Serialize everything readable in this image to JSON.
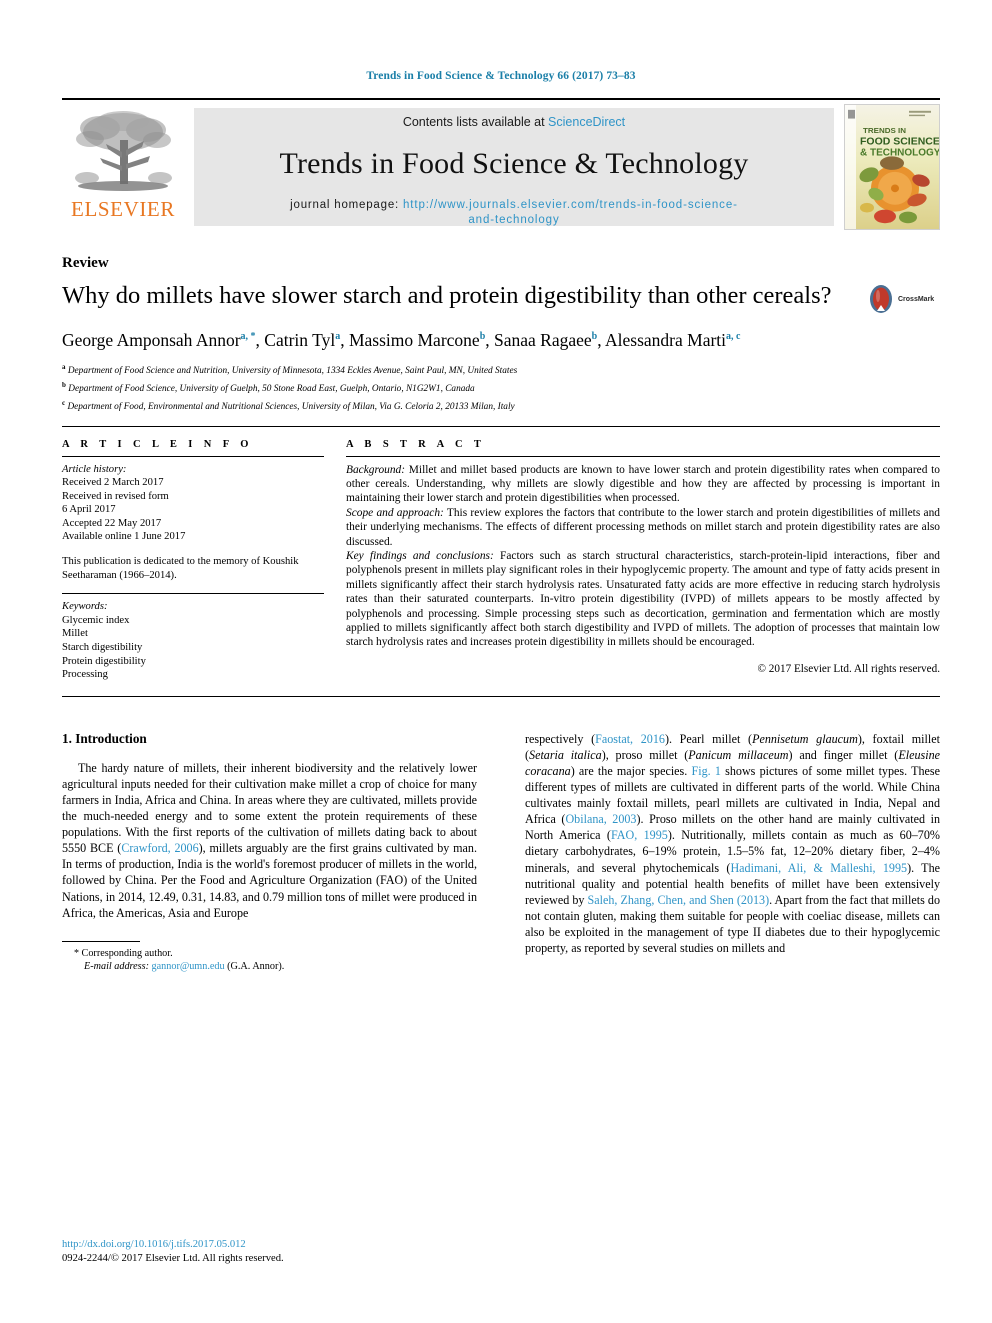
{
  "running_head": "Trends in Food Science & Technology 66 (2017) 73–83",
  "masthead": {
    "publisher": "ELSEVIER",
    "contents_prefix": "Contents lists available at ",
    "contents_link": "ScienceDirect",
    "journal_title": "Trends in Food Science & Technology",
    "homepage_prefix": "journal homepage: ",
    "homepage_url_line1": "http://www.journals.elsevier.com/trends-in-food-science-",
    "homepage_url_line2": "and-technology",
    "cover_title_line1": "TRENDS IN",
    "cover_title_line2": "FOOD SCIENCE",
    "cover_title_line3": "& TECHNOLOGY"
  },
  "article": {
    "doctype": "Review",
    "title": "Why do millets have slower starch and protein digestibility than other cereals?",
    "crossmark_label": "CrossMark",
    "authors_line1_parts": [
      {
        "name": "George Amponsah Annor",
        "sup": "a, *"
      },
      {
        "name": "Catrin Tyl",
        "sup": "a"
      },
      {
        "name": "Massimo Marcone",
        "sup": "b"
      },
      {
        "name": "Sanaa Ragaee",
        "sup": "b"
      }
    ],
    "authors_line2_parts": [
      {
        "name": "Alessandra Marti",
        "sup": "a, c"
      }
    ],
    "affiliations": [
      {
        "marker": "a",
        "text": "Department of Food Science and Nutrition, University of Minnesota, 1334 Eckles Avenue, Saint Paul, MN, United States"
      },
      {
        "marker": "b",
        "text": "Department of Food Science, University of Guelph, 50 Stone Road East, Guelph, Ontario, N1G2W1, Canada"
      },
      {
        "marker": "c",
        "text": "Department of Food, Environmental and Nutritional Sciences, University of Milan, Via G. Celoria 2, 20133 Milan, Italy"
      }
    ]
  },
  "article_info": {
    "heading": "A R T I C L E  I N F O",
    "history_label": "Article history:",
    "history_lines": [
      "Received 2 March 2017",
      "Received in revised form",
      "6 April 2017",
      "Accepted 22 May 2017",
      "Available online 1 June 2017"
    ],
    "dedication": "This publication is dedicated to the memory of Koushik Seetharaman (1966–2014).",
    "keywords_label": "Keywords:",
    "keywords": [
      "Glycemic index",
      "Millet",
      "Starch digestibility",
      "Protein digestibility",
      "Processing"
    ]
  },
  "abstract": {
    "heading": "A B S T R A C T",
    "background_label": "Background:",
    "background_text": " Millet and millet based products are known to have lower starch and protein digestibility rates when compared to other cereals. Understanding, why millets are slowly digestible and how they are affected by processing is important in maintaining their lower starch and protein digestibilities when processed.",
    "scope_label": "Scope and approach:",
    "scope_text": " This review explores the factors that contribute to the lower starch and protein digestibilities of millets and their underlying mechanisms. The effects of different processing methods on millet starch and protein digestibility rates are also discussed.",
    "findings_label": "Key findings and conclusions:",
    "findings_text": " Factors such as starch structural characteristics, starch-protein-lipid interactions, fiber and polyphenols present in millets play significant roles in their hypoglycemic property. The amount and type of fatty acids present in millets significantly affect their starch hydrolysis rates. Unsaturated fatty acids are more effective in reducing starch hydrolysis rates than their saturated counterparts. In-vitro protein digestibility (IVPD) of millets appears to be mostly affected by polyphenols and processing. Simple processing steps such as decortication, germination and fermentation which are mostly applied to millets significantly affect both starch digestibility and IVPD of millets. The adoption of processes that maintain low starch hydrolysis rates and increases protein digestibility in millets should be encouraged.",
    "copyright": "© 2017 Elsevier Ltd. All rights reserved."
  },
  "introduction": {
    "section_number_title": "1. Introduction",
    "left_paragraph": "The hardy nature of millets, their inherent biodiversity and the relatively lower agricultural inputs needed for their cultivation make millet a crop of choice for many farmers in India, Africa and China. In areas where they are cultivated, millets provide the much-needed energy and to some extent the protein requirements of these populations. With the first reports of the cultivation of millets dating back to about 5550 BCE (",
    "left_ref1": "Crawford, 2006",
    "left_paragraph_2": "), millets arguably are the first grains cultivated by man. In terms of production, India is the world's foremost producer of millets in the world, followed by China. Per the Food and Agriculture Organization (FAO) of the United Nations, in 2014, 12.49, 0.31, 14.83, and 0.79 million tons of millet were produced in Africa, the Americas, Asia and Europe",
    "right_segments": [
      {
        "t": "respectively (",
        "k": "plain"
      },
      {
        "t": "Faostat, 2016",
        "k": "ref"
      },
      {
        "t": "). Pearl millet (",
        "k": "plain"
      },
      {
        "t": "Pennisetum glaucum",
        "k": "ital"
      },
      {
        "t": "), foxtail millet (",
        "k": "plain"
      },
      {
        "t": "Setaria italica",
        "k": "ital"
      },
      {
        "t": "), proso millet (",
        "k": "plain"
      },
      {
        "t": "Panicum millaceum",
        "k": "ital"
      },
      {
        "t": ") and finger millet (",
        "k": "plain"
      },
      {
        "t": "Eleusine coracana",
        "k": "ital"
      },
      {
        "t": ") are the major species. ",
        "k": "plain"
      },
      {
        "t": "Fig. 1",
        "k": "ref"
      },
      {
        "t": " shows pictures of some millet types. These different types of millets are cultivated in different parts of the world. While China cultivates mainly foxtail millets, pearl millets are cultivated in India, Nepal and Africa (",
        "k": "plain"
      },
      {
        "t": "Obilana, 2003",
        "k": "ref"
      },
      {
        "t": "). Proso millets on the other hand are mainly cultivated in North America (",
        "k": "plain"
      },
      {
        "t": "FAO, 1995",
        "k": "ref"
      },
      {
        "t": "). Nutritionally, millets contain as much as 60–70% dietary carbohydrates, 6–19% protein, 1.5–5% fat, 12–20% dietary fiber, 2–4% minerals, and several phytochemicals (",
        "k": "plain"
      },
      {
        "t": "Hadimani, Ali, & Malleshi, 1995",
        "k": "ref"
      },
      {
        "t": "). The nutritional quality and potential health benefits of millet have been extensively reviewed by ",
        "k": "plain"
      },
      {
        "t": "Saleh, Zhang, Chen, and Shen (2013)",
        "k": "ref"
      },
      {
        "t": ". Apart from the fact that millets do not contain gluten, making them suitable for people with coeliac disease, millets can also be exploited in the management of type II diabetes due to their hypoglycemic property, as reported by several studies on millets and",
        "k": "plain"
      }
    ]
  },
  "footnotes": {
    "corresponding_star": "*",
    "corresponding_label": "Corresponding author.",
    "email_label": "E-mail address:",
    "email": "gannor@umn.edu",
    "email_suffix": " (G.A. Annor).",
    "doi": "http://dx.doi.org/10.1016/j.tifs.2017.05.012",
    "issn_line": "0924-2244/© 2017 Elsevier Ltd. All rights reserved."
  },
  "colors": {
    "link_blue": "#2f94c7",
    "header_blue": "#1b7fa8",
    "elsevier_orange": "#E87722",
    "crossmark_red": "#c0392b",
    "band_gray": "#e6e6e6"
  }
}
